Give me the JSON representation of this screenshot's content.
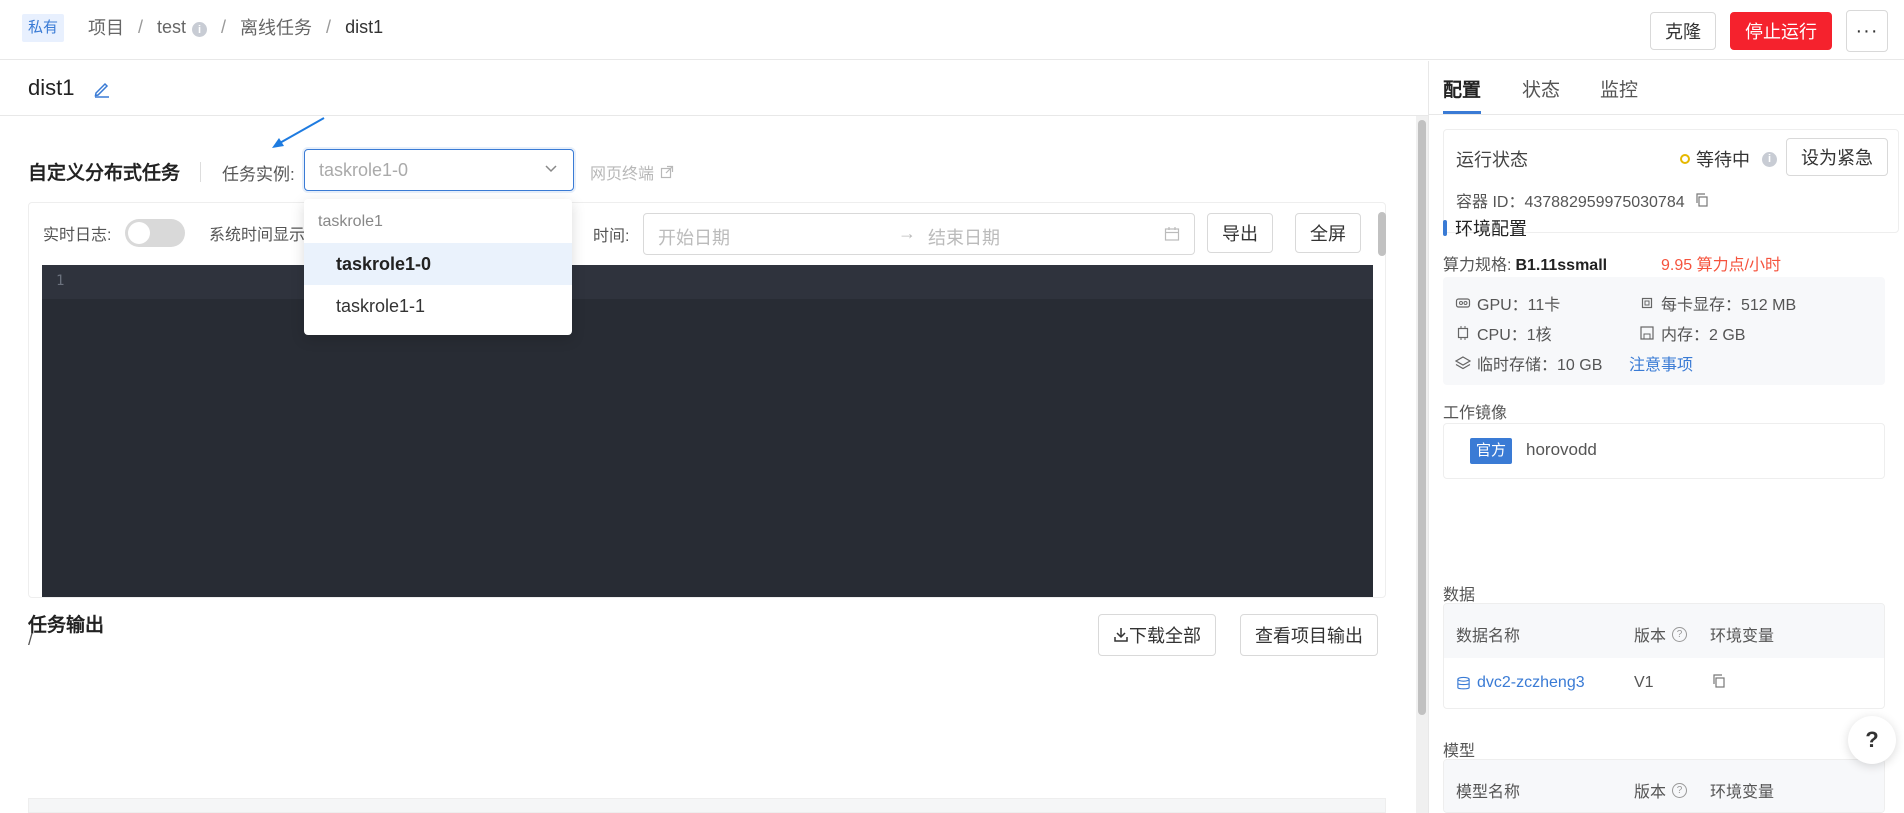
{
  "topbar": {
    "private_tag": "私有",
    "breadcrumb": [
      "项目",
      "test",
      "离线任务",
      "dist1"
    ],
    "clone_label": "克隆",
    "stop_label": "停止运行",
    "more_label": "···"
  },
  "task": {
    "name": "dist1"
  },
  "main": {
    "section_title": "自定义分布式任务",
    "instance_label": "任务实例:",
    "instance_value": "taskrole1-0",
    "web_terminal": "网页终端",
    "log": {
      "realtime_label": "实时日志:",
      "systime_label": "系统时间显示",
      "time_label": "时间:",
      "start_placeholder": "开始日期",
      "end_placeholder": "结束日期",
      "export_label": "导出",
      "fullscreen_label": "全屏",
      "line_no": "1"
    },
    "output_title": "任务输出",
    "output_path": "/",
    "download_all": "下载全部",
    "view_project_output": "查看项目输出"
  },
  "dropdown": {
    "group": "taskrole1",
    "options": [
      "taskrole1-0",
      "taskrole1-1"
    ],
    "selected": "taskrole1-0"
  },
  "right": {
    "tabs": [
      "配置",
      "状态",
      "监控"
    ],
    "run_status_label": "运行状态",
    "run_status_value": "等待中",
    "urgent_label": "设为紧急",
    "container_id": "容器 ID：437882959975030784",
    "env_title": "环境配置",
    "spec_label": "算力规格:",
    "spec_value": "B1.11ssmall",
    "spec_price": "9.95 算力点/小时",
    "gpu": "GPU：11卡",
    "vram": "每卡显存：512 MB",
    "cpu": "CPU：1核",
    "mem": "内存：2 GB",
    "temp_storage": "临时存储：10 GB",
    "notice_link": "注意事项",
    "image_title": "工作镜像",
    "image_badge": "官方",
    "image_name": "horovodd",
    "data_title": "数据",
    "data_cols": [
      "数据名称",
      "版本",
      "环境变量"
    ],
    "data_rows": [
      {
        "name": "dvc2-zczheng3",
        "version": "V1"
      }
    ],
    "model_title": "模型",
    "model_cols": [
      "模型名称",
      "版本",
      "环境变量"
    ]
  },
  "help_label": "?",
  "colors": {
    "accent": "#3a7bd5",
    "danger": "#f5222d",
    "code_bg": "#282c34",
    "price": "#f5533d"
  }
}
